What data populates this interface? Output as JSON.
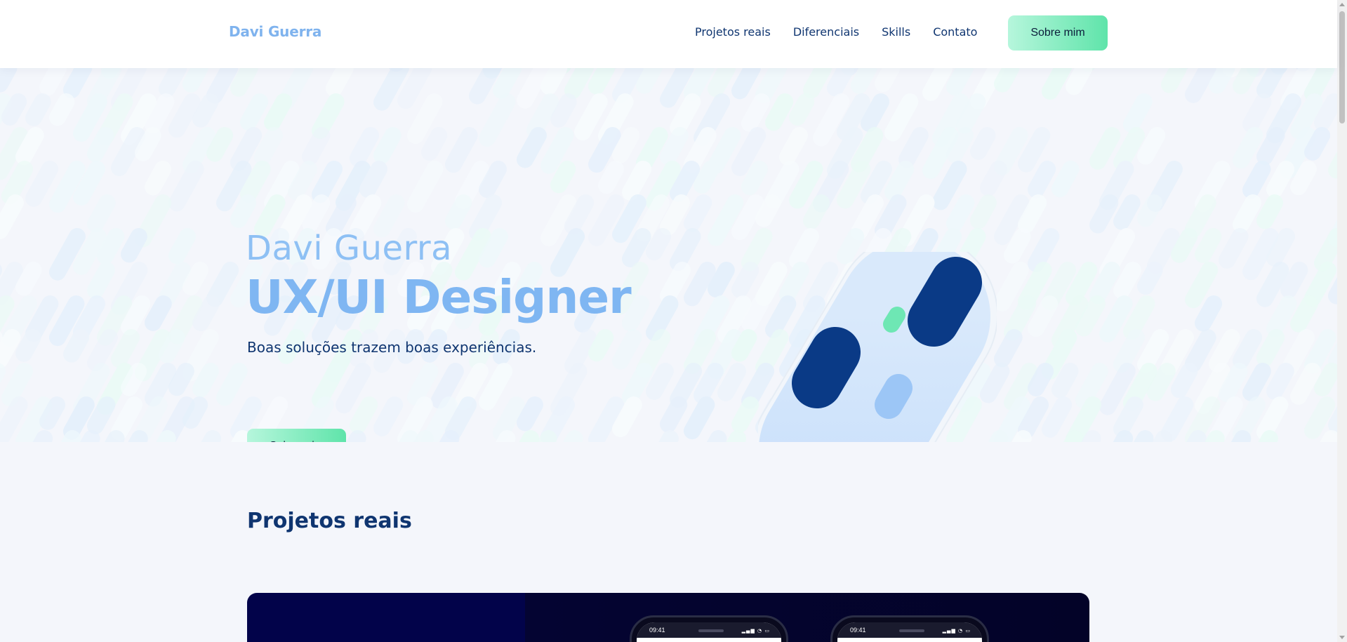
{
  "header": {
    "logo": "Davi Guerra",
    "nav": [
      {
        "label": "Projetos reais"
      },
      {
        "label": "Diferenciais"
      },
      {
        "label": "Skills"
      },
      {
        "label": "Contato"
      }
    ],
    "cta_label": "Sobre mim"
  },
  "hero": {
    "name": "Davi Guerra",
    "role": "UX/UI Designer",
    "tagline": "Boas soluções trazem boas experiências.",
    "cta_label": "Sobre mim"
  },
  "projects": {
    "title": "Projetos reais",
    "phones": [
      {
        "time": "09:41"
      },
      {
        "time": "09:41"
      }
    ]
  },
  "colors": {
    "brand_light_blue": "#7fb6f2",
    "navy": "#0f3570",
    "mint": "#5fe4aa",
    "dark_blue_pill": "#0a3a86",
    "project_card_bg": "#02034a"
  },
  "icons": [
    "signal-icon",
    "wifi-icon",
    "battery-icon"
  ]
}
